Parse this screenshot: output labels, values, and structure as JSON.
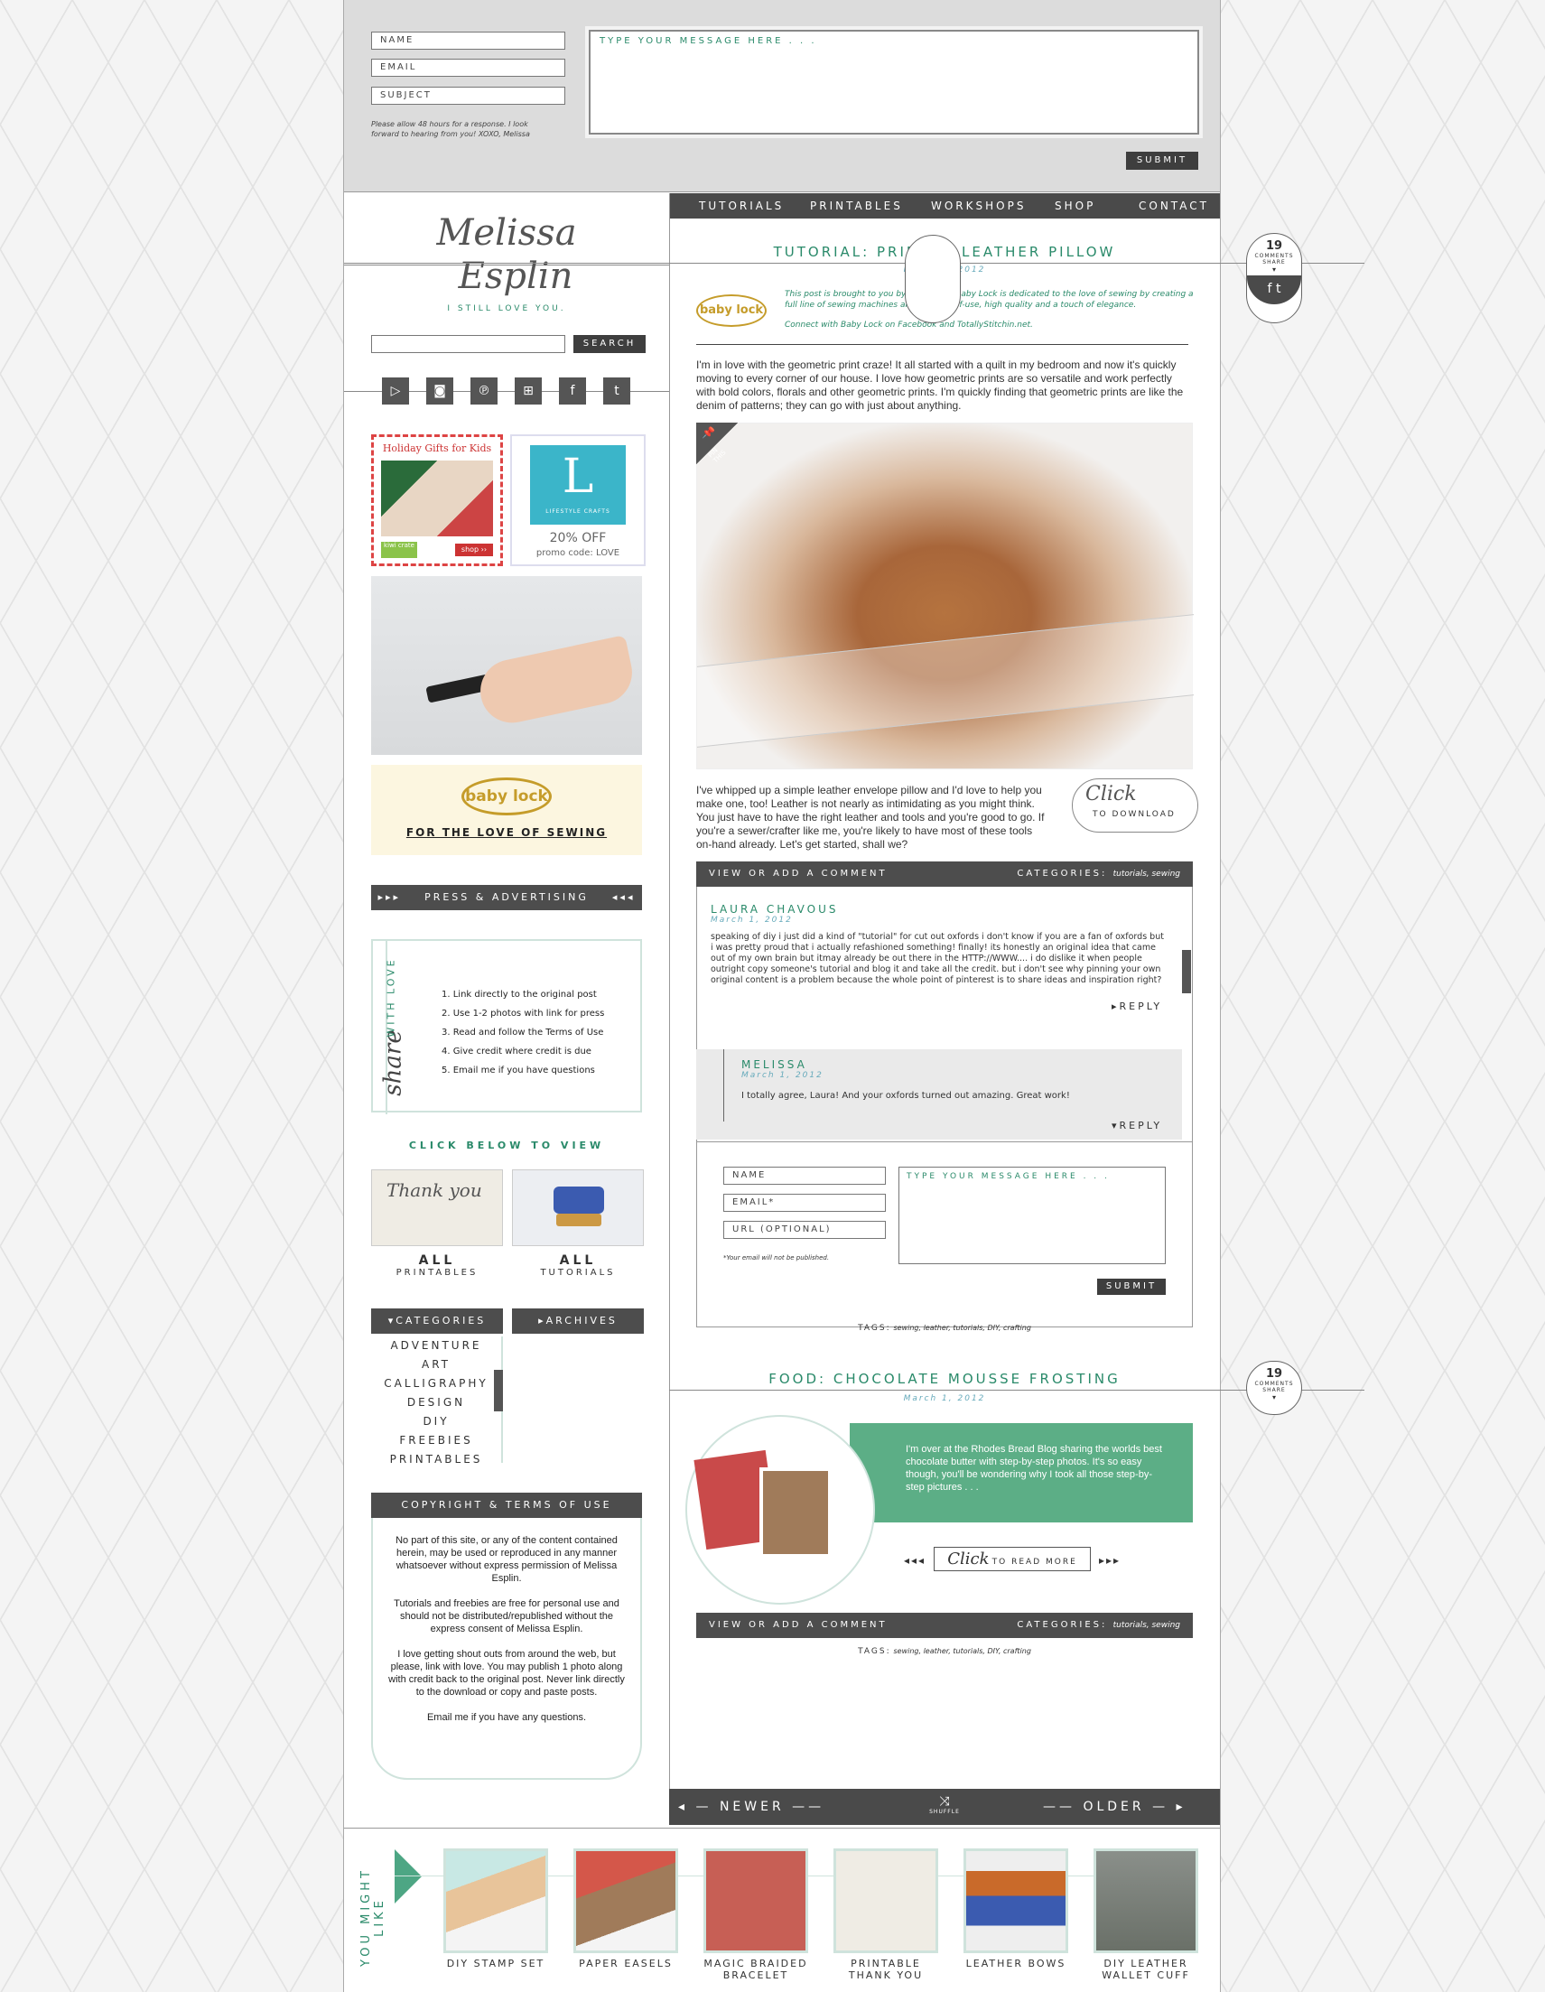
{
  "contact": {
    "name": "NAME",
    "email": "EMAIL",
    "subject": "SUBJECT",
    "message_placeholder": "TYPE YOUR MESSAGE HERE . . .",
    "note": "Please allow 48 hours for a response. I look forward to hearing from you!  XOXO, Melissa",
    "submit": "SUBMIT"
  },
  "nav": [
    "TUTORIALS",
    "PRINTABLES",
    "WORKSHOPS",
    "SHOP",
    "CONTACT"
  ],
  "logo": {
    "line1": "Melissa",
    "line2": "Esplin",
    "tagline": "I STILL LOVE YOU."
  },
  "search": {
    "button": "SEARCH"
  },
  "social_icons": [
    "youtube-icon",
    "instagram-icon",
    "pinterest-icon",
    "cart-icon",
    "facebook-icon",
    "twitter-icon"
  ],
  "ads": {
    "kiwi_title": "Holiday Gifts for Kids",
    "kiwi_logo": "kiwi crate",
    "kiwi_shop": "shop ››",
    "lifestyle_letter": "L",
    "lifestyle_name": "LIFESTYLE CRAFTS",
    "lifestyle_offer": "20% OFF",
    "lifestyle_code": "promo code: LOVE",
    "babylock_logo": "baby lock",
    "babylock_tag": "FOR THE LOVE OF SEWING"
  },
  "press": {
    "title": "PRESS & ADVERTISING",
    "arrows_left": "▸▸▸",
    "arrows_right": "◂◂◂"
  },
  "share": {
    "script": "share",
    "caps": "WITH LOVE",
    "rules": [
      "1. Link directly to the original post",
      "2. Use 1-2 photos with link for press",
      "3. Read and follow the Terms of Use",
      "4. Give credit where credit is due",
      "5. Email me if you have questions"
    ]
  },
  "view_all": {
    "arc": "CLICK BELOW TO VIEW",
    "all": "ALL",
    "printables": "PRINTABLES",
    "tutorials": "TUTORIALS"
  },
  "categories": {
    "title": "CATEGORIES",
    "archives": "ARCHIVES",
    "items": [
      "ADVENTURE",
      "ART",
      "CALLIGRAPHY",
      "DESIGN",
      "DIY",
      "FREEBIES",
      "PRINTABLES"
    ]
  },
  "copyright": {
    "title": "COPYRIGHT & TERMS OF USE",
    "p1": "No part of this site, or any of the content contained herein, may be used or reproduced in any manner whatsoever without express permission of Melissa Esplin.",
    "p2": "Tutorials and freebies are free for personal use and should not be distributed/republished without the express consent of Melissa Esplin.",
    "p3": "I love getting shout outs from around the web, but please, link with love. You may publish 1 photo along with credit back to the original post. Never link directly to the download or copy and paste posts.",
    "p4": "Email me if you have any questions."
  },
  "post1": {
    "title": "TUTORIAL: PRINTED LEATHER PILLOW",
    "date": "March 2, 2012",
    "comments_count": "19",
    "comments_label": "COMMENTS",
    "share_label": "SHARE",
    "sponsor_logo": "baby lock",
    "sponsor_text": "This post is brought to you by Baby Lock. Baby Lock is dedicated to the love of sewing by creating a full line of sewing machines all with ease-of-use, high quality and a touch of elegance.",
    "sponsor_connect": "Connect with Baby Lock on Facebook and TotallyStitchin.net.",
    "intro": "I'm in love with the geometric print craze! It all started with a quilt in my bedroom and now it's quickly moving to every corner of our house. I love how geometric prints are so versatile and work perfectly with bold colors, florals and other geometric prints. I'm quickly finding that geometric prints are like the denim of patterns; they can go with just about anything.",
    "pin": "PIN THIS",
    "body": "I've whipped up a simple leather envelope pillow and I'd love to help you make one, too! Leather is not nearly as intimidating as you might think. You just have to have the right leather and tools and you're good to go. If you're a sewer/crafter like me, you're likely to have most of these tools on-hand already. Let's get started, shall we?",
    "click": "Click",
    "to_download": "TO DOWNLOAD",
    "view_comment": "VIEW OR ADD A COMMENT",
    "categories_label": "CATEGORIES:",
    "categories_value": "tutorials, sewing",
    "tags_label": "TAGS:",
    "tags_value": "sewing, leather, tutorials, DIY, crafting"
  },
  "comment1": {
    "author": "LAURA CHAVOUS",
    "date": "March 1, 2012",
    "text": "speaking of diy i just did a kind of \"tutorial\" for cut out oxfords i don't know if you are a fan of oxfords but i was pretty proud that i actually refashioned something! finally! its honestly an original idea that came out of my own brain but itmay already be out there in the HTTP://WWW.... i do dislike it when people outright copy someone's tutorial and blog it and take all the credit. but i don't see why pinning your own original content is a problem because the whole point of pinterest is to share ideas and inspiration right?",
    "reply": "REPLY"
  },
  "comment2": {
    "author": "MELISSA",
    "date": "March 1, 2012",
    "text": "I totally agree, Laura! And your oxfords turned out amazing. Great work!",
    "reply": "REPLY"
  },
  "comment_form": {
    "name": "NAME",
    "email": "EMAIL*",
    "url": "URL (OPTIONAL)",
    "message_placeholder": "TYPE YOUR MESSAGE HERE . . .",
    "note": "*Your email will not be published.",
    "submit": "SUBMIT"
  },
  "post2": {
    "title": "FOOD: CHOCOLATE MOUSSE FROSTING",
    "date": "March 1, 2012",
    "comments_count": "19",
    "comments_label": "COMMENTS",
    "share_label": "SHARE",
    "teaser": "I'm over at the Rhodes Bread Blog sharing the worlds best chocolate butter with step-by-step photos. It's so easy though, you'll be wondering why I took all those step-by-step pictures . . .",
    "click": "Click",
    "read_more": "TO READ MORE",
    "view_comment": "VIEW OR ADD A COMMENT",
    "categories_label": "CATEGORIES:",
    "categories_value": "tutorials, sewing",
    "tags_label": "TAGS:",
    "tags_value": "sewing, leather, tutorials, DIY, crafting"
  },
  "pagination": {
    "newer": "NEWER",
    "shuffle": "SHUFFLE",
    "older": "OLDER"
  },
  "you_might_like": {
    "title": "YOU MIGHT LIKE",
    "items": [
      {
        "l1": "DIY STAMP SET",
        "l2": ""
      },
      {
        "l1": "PAPER EASELS",
        "l2": ""
      },
      {
        "l1": "MAGIC BRAIDED",
        "l2": "BRACELET"
      },
      {
        "l1": "PRINTABLE",
        "l2": "THANK YOU"
      },
      {
        "l1": "LEATHER BOWS",
        "l2": ""
      },
      {
        "l1": "DIY LEATHER",
        "l2": "WALLET CUFF"
      }
    ]
  },
  "colors": {
    "accent": "#2a8a6a",
    "dark": "#4a4a4a",
    "contact_bg": "#dcdcdc"
  }
}
